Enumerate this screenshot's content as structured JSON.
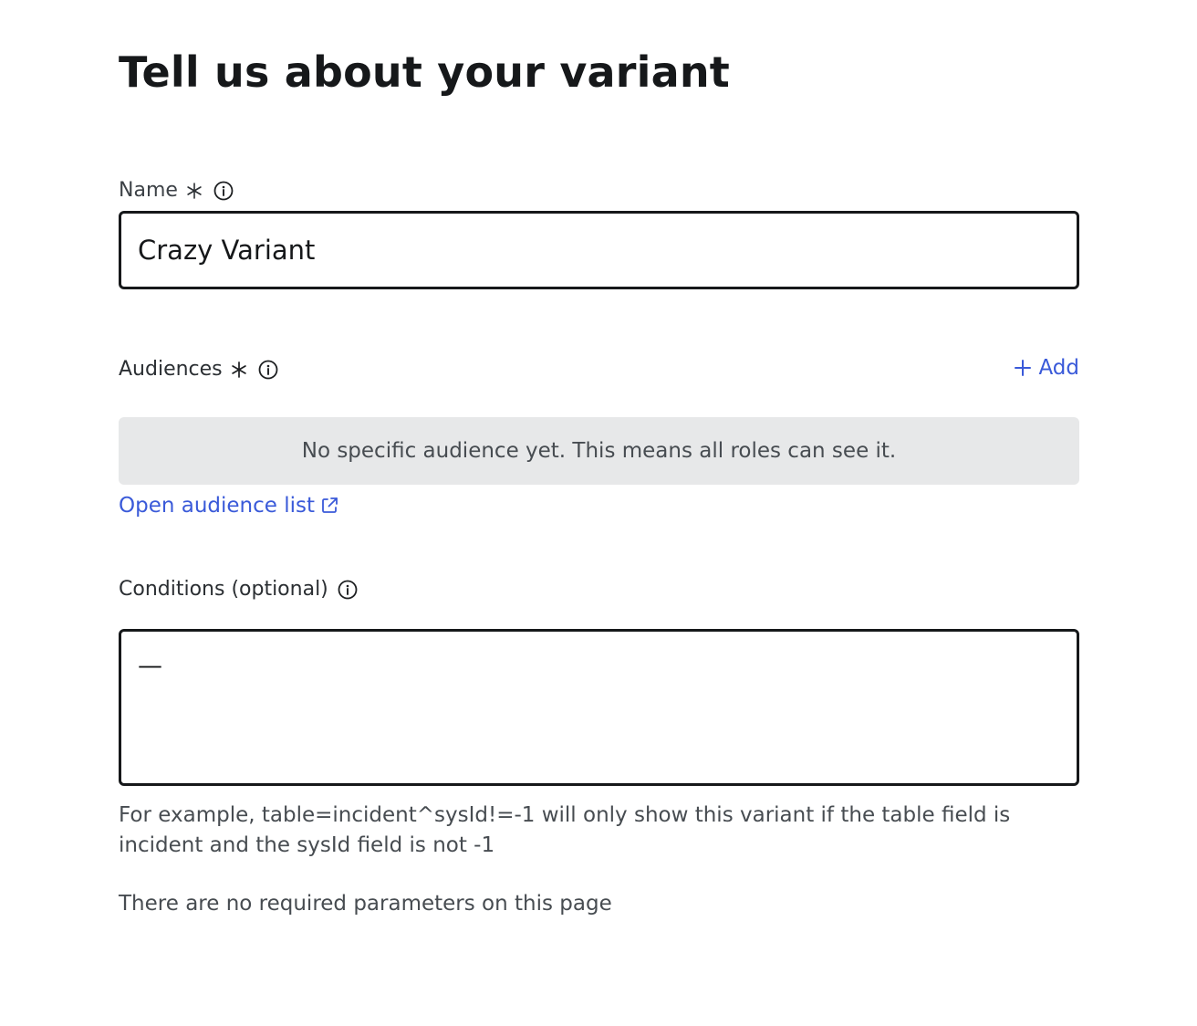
{
  "page": {
    "title": "Tell us about your variant"
  },
  "name_field": {
    "label": "Name",
    "value": "Crazy Variant",
    "required": true
  },
  "audiences": {
    "label": "Audiences",
    "required": true,
    "add_label": "Add",
    "empty_message": "No specific audience yet. This means all roles can see it.",
    "open_list_label": "Open audience list"
  },
  "conditions": {
    "label": "Conditions (optional)",
    "value": "—",
    "helper": "For example, table=incident^sysId!=-1 will only show this variant if the table field is incident and the sysId field is not -1"
  },
  "footer_note": "There are no required parameters on this page",
  "icons": {
    "required": "asterisk-icon",
    "info": "info-icon",
    "add": "plus-icon",
    "external": "external-link-icon"
  },
  "colors": {
    "link": "#3a5ad9",
    "input_border": "#16181a",
    "empty_state_bg": "#e7e8e9",
    "muted_text": "#474c51"
  }
}
